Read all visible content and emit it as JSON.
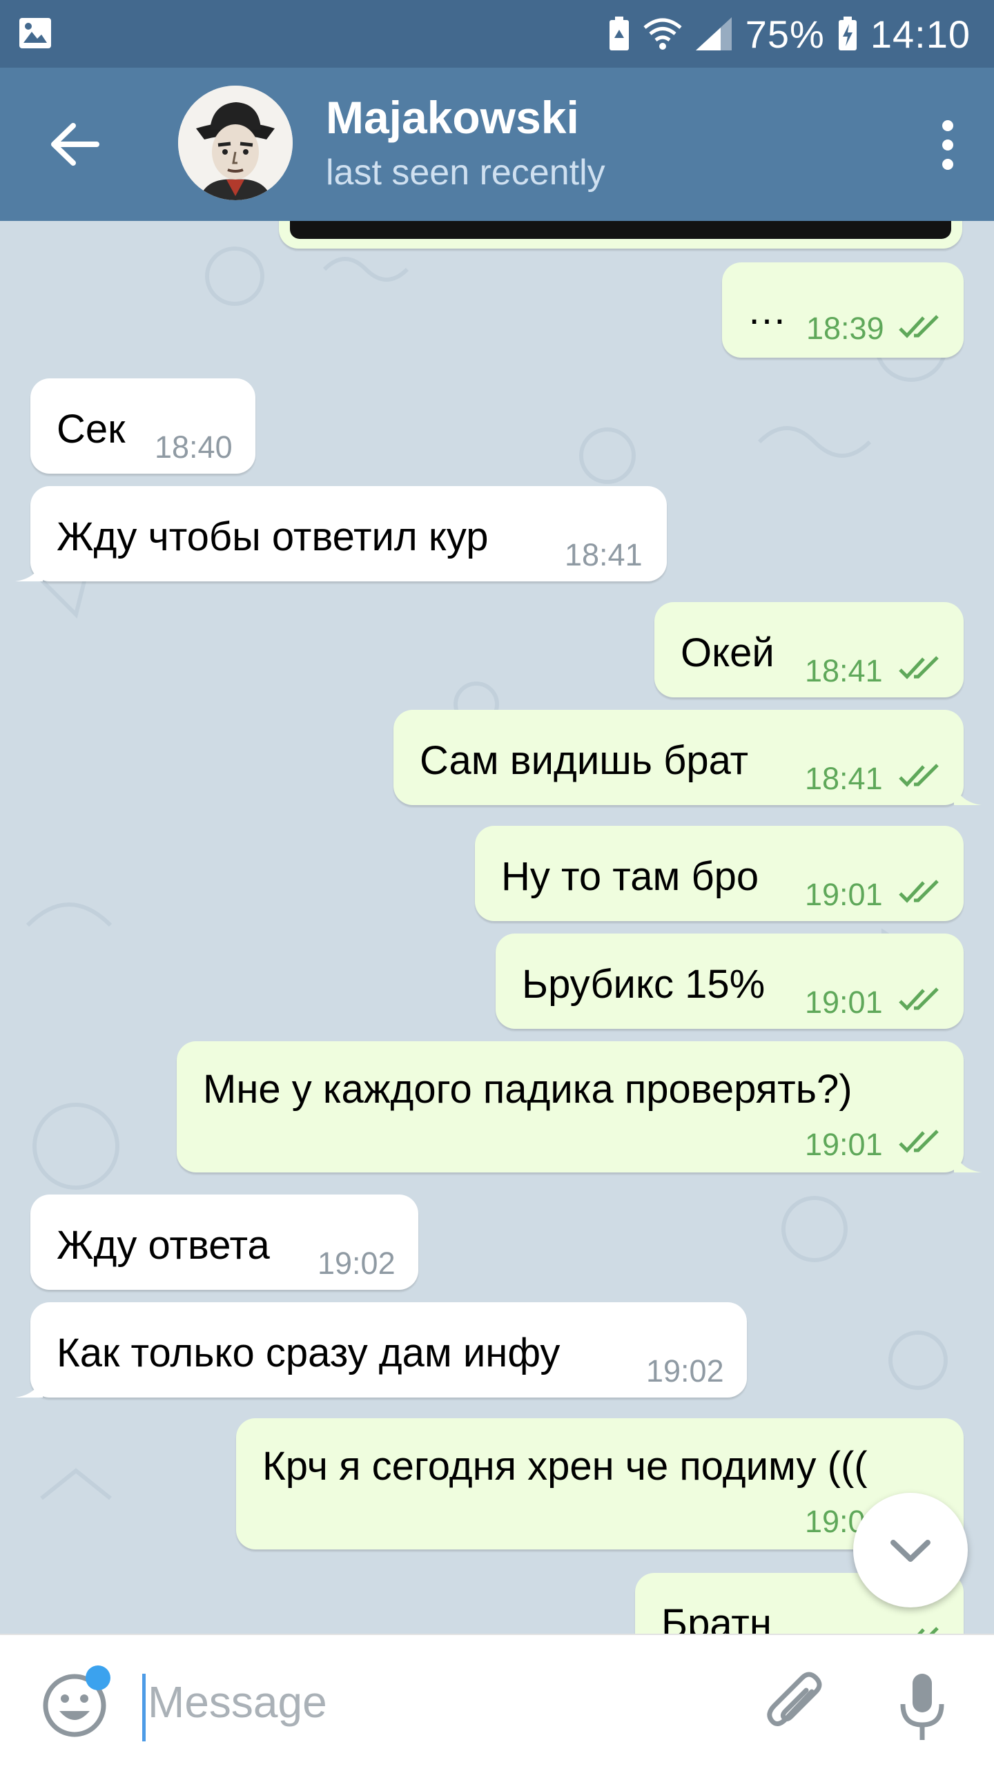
{
  "status_bar": {
    "battery_percent": "75%",
    "time": "14:10",
    "icons": [
      "gallery-icon",
      "battery-saver-icon",
      "wifi-icon",
      "signal-icon",
      "battery-charging-icon"
    ]
  },
  "header": {
    "contact_name": "Majakowski",
    "contact_status": "last seen recently",
    "back_icon": "arrow-left-icon",
    "menu_icon": "more-vertical-icon"
  },
  "messages": [
    {
      "dir": "out",
      "text": "…",
      "time": "18:39",
      "read": true
    },
    {
      "dir": "in",
      "text": "Сек",
      "time": "18:40"
    },
    {
      "dir": "in",
      "text": "Жду чтобы ответил кур",
      "time": "18:41"
    },
    {
      "dir": "out",
      "text": "Окей",
      "time": "18:41",
      "read": true
    },
    {
      "dir": "out",
      "text": "Сам видишь брат",
      "time": "18:41",
      "read": true
    },
    {
      "dir": "out",
      "text": "Ну то там бро",
      "time": "19:01",
      "read": true
    },
    {
      "dir": "out",
      "text": "Ьрубикс 15%",
      "time": "19:01",
      "read": true
    },
    {
      "dir": "out",
      "text": "Мне у каждого падика проверять?)",
      "time": "19:01",
      "read": true
    },
    {
      "dir": "in",
      "text": "Жду ответа",
      "time": "19:02"
    },
    {
      "dir": "in",
      "text": "Как только сразу дам инфу",
      "time": "19:02"
    },
    {
      "dir": "out",
      "text": "Крч я сегодня хрен че подиму (((",
      "time": "19:0",
      "read": true
    },
    {
      "dir": "out",
      "text": "Братн",
      "time": "",
      "read": true
    }
  ],
  "input": {
    "placeholder": "Message",
    "emoji_icon": "emoji-icon",
    "attach_icon": "paperclip-icon",
    "mic_icon": "microphone-icon"
  },
  "scroll_button_icon": "chevron-down-icon",
  "colors": {
    "status_bar": "#43698e",
    "header": "#527da3",
    "chat_background": "#cfdbe4",
    "incoming_bubble": "#ffffff",
    "outgoing_bubble": "#effdde",
    "outgoing_time": "#5fa85a",
    "unread_dot": "#3ba2ee"
  }
}
